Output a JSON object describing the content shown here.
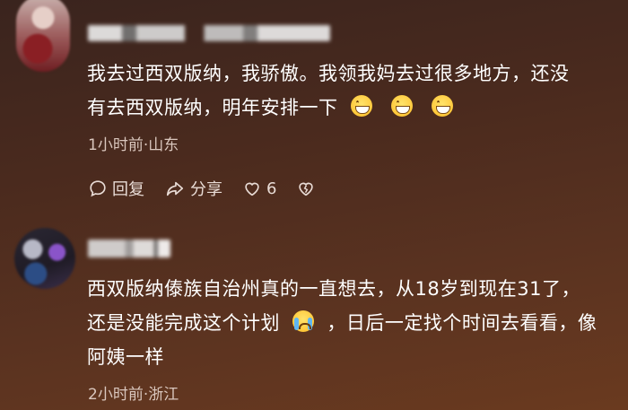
{
  "comments": [
    {
      "text_line1": "我去过西双版纳，我骄傲。我领我妈去过很多地方，还没",
      "text_line2": "有去西双版纳，明年安排一下",
      "emoji": [
        "grin-icon",
        "grin-icon",
        "grin-icon"
      ],
      "meta": "1小时前·山东",
      "actions": {
        "reply_label": "回复",
        "share_label": "分享",
        "like_count": "6"
      }
    },
    {
      "text_line1": "西双版纳傣族自治州真的一直想去，从18岁到现在31了，",
      "text_line2a": "还是没能完成这个计划",
      "text_line2b": "，日后一定找个时间去看看，像",
      "text_line3": "阿姨一样",
      "emoji": [
        "crying-face-icon"
      ],
      "meta": "2小时前·浙江"
    }
  ],
  "colors": {
    "background_top": "#3a241e",
    "background_bottom": "#6a3a1f",
    "text": "#ffffff",
    "meta": "#d9c6bd"
  }
}
